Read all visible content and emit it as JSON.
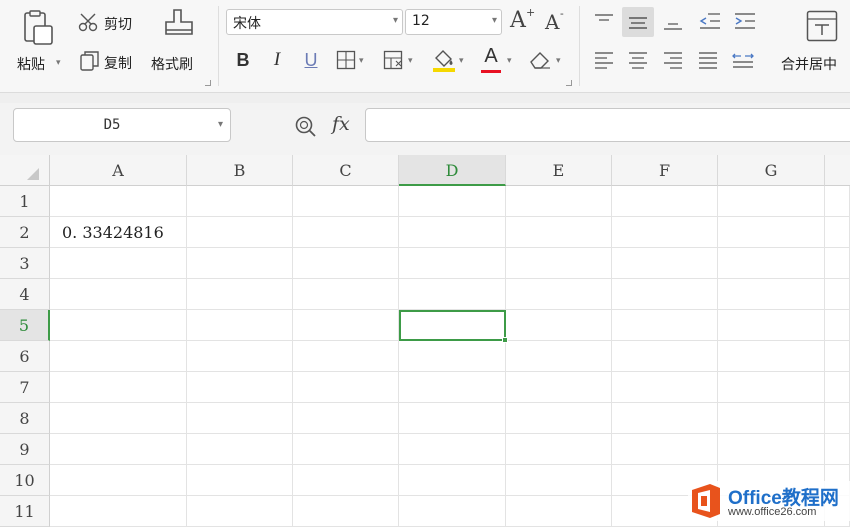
{
  "ribbon": {
    "clipboard": {
      "paste_label": "粘贴",
      "cut_label": "剪切",
      "copy_label": "复制",
      "format_painter_label": "格式刷"
    },
    "font": {
      "font_name": "宋体",
      "font_size": "12",
      "grow_label": "A",
      "shrink_label": "A",
      "bold_label": "B",
      "italic_label": "I",
      "underline_label": "U",
      "font_color_label": "A",
      "font_color": "#e81123",
      "fill_color": "#f5d800"
    },
    "alignment": {
      "merge_center_label": "合并居中"
    }
  },
  "formula_bar": {
    "name_box": "D5",
    "fx_label": "fx",
    "formula_value": ""
  },
  "sheet": {
    "columns": [
      "A",
      "B",
      "C",
      "D",
      "E",
      "F",
      "G"
    ],
    "rows": [
      "1",
      "2",
      "3",
      "4",
      "5",
      "6",
      "7",
      "8",
      "9",
      "10",
      "11"
    ],
    "cell_A2": "0. 33424816",
    "active_cell": "D5",
    "selection_color": "#3d9b47"
  },
  "watermark": {
    "title": "Office教程网",
    "url": "www.office26.com",
    "logo_color": "#e8531c"
  }
}
